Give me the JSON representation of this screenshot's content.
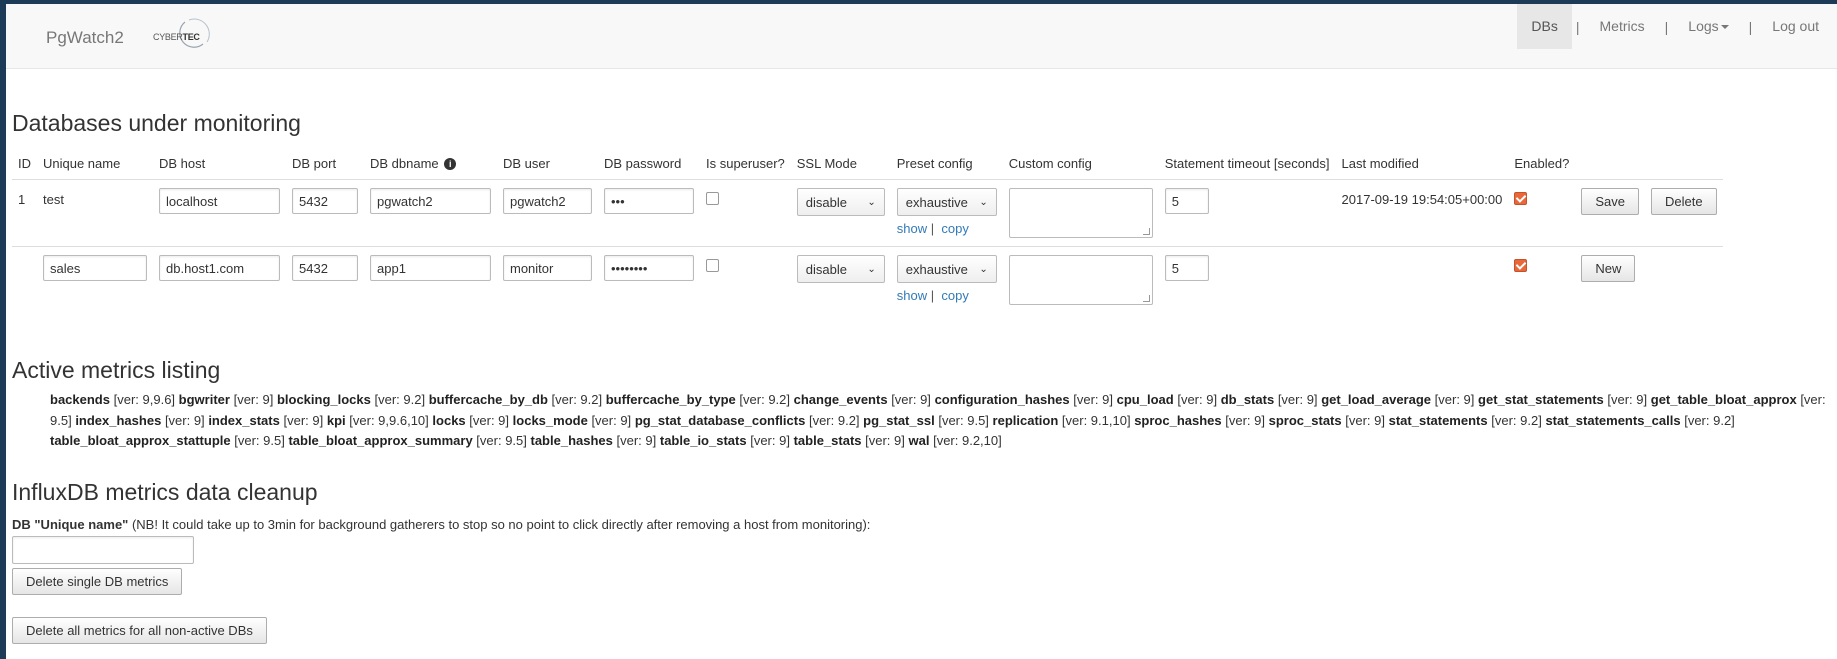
{
  "navbar": {
    "brand": "PgWatch2",
    "logo_text_a": "CYBER",
    "logo_text_b": "TEC",
    "items": [
      {
        "label": "DBs",
        "active": true
      },
      {
        "label": "Metrics"
      },
      {
        "label": "Logs"
      },
      {
        "label": "Log out"
      }
    ],
    "separator": "|"
  },
  "databases": {
    "title": "Databases under monitoring",
    "columns": [
      "ID",
      "Unique name",
      "DB host",
      "DB port",
      "DB dbname",
      "DB user",
      "DB password",
      "Is superuser?",
      "SSL Mode",
      "Preset config",
      "Custom config",
      "Statement timeout [seconds]",
      "Last modified",
      "Enabled?"
    ],
    "rows": [
      {
        "id": "1",
        "unique_name": "test",
        "host": "localhost",
        "port": "5432",
        "dbname": "pgwatch2",
        "user": "pgwatch2",
        "password": "•••",
        "superuser": false,
        "ssl_mode": "disable",
        "preset": "exhaustive",
        "timeout": "5",
        "last_modified": "2017-09-19 19:54:05+00:00",
        "enabled": true,
        "show_label": "show",
        "link_sep": "|",
        "copy_label": "copy",
        "save_label": "Save",
        "delete_label": "Delete"
      },
      {
        "id": "",
        "unique_name": "sales",
        "host": "db.host1.com",
        "port": "5432",
        "dbname": "app1",
        "user": "monitor",
        "password": "••••••••",
        "superuser": false,
        "ssl_mode": "disable",
        "preset": "exhaustive",
        "timeout": "5",
        "last_modified": "",
        "enabled": true,
        "show_label": "show",
        "link_sep": "|",
        "copy_label": "copy",
        "new_label": "New"
      }
    ]
  },
  "metrics": {
    "title": "Active metrics listing",
    "items": [
      {
        "name": "backends",
        "ver": "[ver: 9,9.6]"
      },
      {
        "name": "bgwriter",
        "ver": "[ver: 9]"
      },
      {
        "name": "blocking_locks",
        "ver": "[ver: 9.2]"
      },
      {
        "name": "buffercache_by_db",
        "ver": "[ver: 9.2]"
      },
      {
        "name": "buffercache_by_type",
        "ver": "[ver: 9.2]"
      },
      {
        "name": "change_events",
        "ver": "[ver: 9]"
      },
      {
        "name": "configuration_hashes",
        "ver": "[ver: 9]"
      },
      {
        "name": "cpu_load",
        "ver": "[ver: 9]"
      },
      {
        "name": "db_stats",
        "ver": "[ver: 9]"
      },
      {
        "name": "get_load_average",
        "ver": "[ver: 9]"
      },
      {
        "name": "get_stat_statements",
        "ver": "[ver: 9]"
      },
      {
        "name": "get_table_bloat_approx",
        "ver": "[ver: 9.5]"
      },
      {
        "name": "index_hashes",
        "ver": "[ver: 9]"
      },
      {
        "name": "index_stats",
        "ver": "[ver: 9]"
      },
      {
        "name": "kpi",
        "ver": "[ver: 9,9.6,10]"
      },
      {
        "name": "locks",
        "ver": "[ver: 9]"
      },
      {
        "name": "locks_mode",
        "ver": "[ver: 9]"
      },
      {
        "name": "pg_stat_database_conflicts",
        "ver": "[ver: 9.2]"
      },
      {
        "name": "pg_stat_ssl",
        "ver": "[ver: 9.5]"
      },
      {
        "name": "replication",
        "ver": "[ver: 9.1,10]"
      },
      {
        "name": "sproc_hashes",
        "ver": "[ver: 9]"
      },
      {
        "name": "sproc_stats",
        "ver": "[ver: 9]"
      },
      {
        "name": "stat_statements",
        "ver": "[ver: 9.2]"
      },
      {
        "name": "stat_statements_calls",
        "ver": "[ver: 9.2]"
      },
      {
        "name": "table_bloat_approx_stattuple",
        "ver": "[ver: 9.5]"
      },
      {
        "name": "table_bloat_approx_summary",
        "ver": "[ver: 9.5]"
      },
      {
        "name": "table_hashes",
        "ver": "[ver: 9]"
      },
      {
        "name": "table_io_stats",
        "ver": "[ver: 9]"
      },
      {
        "name": "table_stats",
        "ver": "[ver: 9]"
      },
      {
        "name": "wal",
        "ver": "[ver: 9.2,10]"
      }
    ]
  },
  "cleanup": {
    "title": "InfluxDB metrics data cleanup",
    "label_bold": "DB \"Unique name\"",
    "label_rest": " (NB! It could take up to 3min for background gatherers to stop so no point to click directly after removing a host from monitoring):",
    "input_value": "",
    "delete_single_label": "Delete single DB metrics",
    "delete_all_label": "Delete all metrics for all non-active DBs"
  }
}
